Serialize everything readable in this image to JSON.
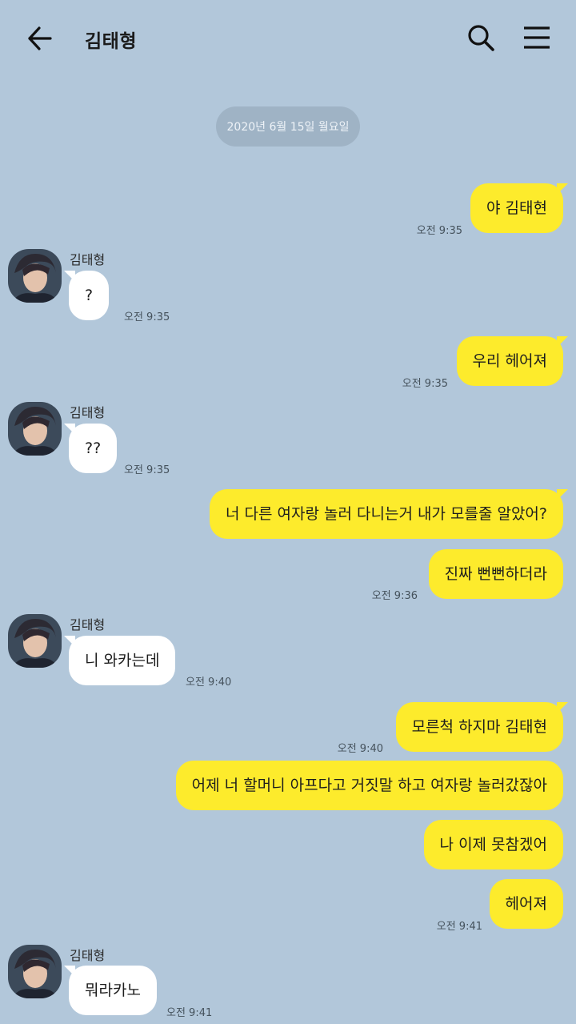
{
  "header": {
    "title": "김태형",
    "back_icon": "arrow-left-icon",
    "search_icon": "search-icon",
    "menu_icon": "hamburger-menu-icon"
  },
  "date_divider": "2020년 6월 15일 월요일",
  "sender_name": "김태형",
  "messages": [
    {
      "from": "me",
      "text": "야 김태현",
      "time": "오전 9:35"
    },
    {
      "from": "them",
      "text": "?",
      "time": "오전 9:35"
    },
    {
      "from": "me",
      "text": "우리 헤어져",
      "time": "오전 9:35"
    },
    {
      "from": "them",
      "text": "??",
      "time": "오전 9:35"
    },
    {
      "from": "me",
      "text": "너 다른 여자랑 놀러 다니는거 내가 모를줄 알았어?",
      "time": ""
    },
    {
      "from": "me",
      "text": "진짜 뻔뻔하더라",
      "time": "오전 9:36"
    },
    {
      "from": "them",
      "text": "니 와카는데",
      "time": "오전 9:40"
    },
    {
      "from": "me",
      "text": "모른척 하지마 김태현",
      "time": "오전 9:40"
    },
    {
      "from": "me",
      "text": "어제 너 할머니 아프다고 거짓말 하고 여자랑 놀러갔잖아",
      "time": ""
    },
    {
      "from": "me",
      "text": "나 이제 못참겠어",
      "time": ""
    },
    {
      "from": "me",
      "text": "헤어져",
      "time": "오전 9:41"
    },
    {
      "from": "them",
      "text": "뭐라카노",
      "time": "오전 9:41"
    }
  ],
  "colors": {
    "background": "#b2c7da",
    "my_bubble": "#fdeb2c",
    "their_bubble": "#ffffff",
    "date_pill": "#9fb3c5"
  }
}
